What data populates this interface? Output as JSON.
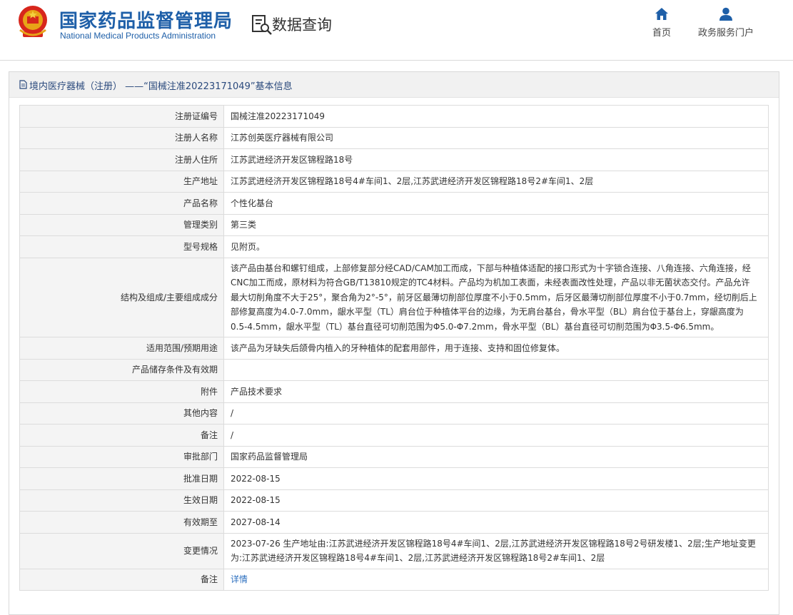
{
  "header": {
    "site_name_cn": "国家药品监督管理局",
    "site_name_en": "National Medical Products Administration",
    "page_title": "数据查询",
    "nav": [
      {
        "label": "首页",
        "icon": "home-icon"
      },
      {
        "label": "政务服务门户",
        "icon": "user-icon"
      }
    ]
  },
  "panel": {
    "title": "境内医疗器械（注册） ——“国械注准20223171049”基本信息",
    "rows": [
      {
        "label": "注册证编号",
        "value": "国械注准20223171049"
      },
      {
        "label": "注册人名称",
        "value": "江苏创英医疗器械有限公司"
      },
      {
        "label": "注册人住所",
        "value": "江苏武进经济开发区锦程路18号"
      },
      {
        "label": "生产地址",
        "value": "江苏武进经济开发区锦程路18号4#车间1、2层,江苏武进经济开发区锦程路18号2#车间1、2层"
      },
      {
        "label": "产品名称",
        "value": "个性化基台"
      },
      {
        "label": "管理类别",
        "value": "第三类"
      },
      {
        "label": "型号规格",
        "value": "见附页。"
      },
      {
        "label": "结构及组成/主要组成成分",
        "value": "该产品由基台和螺钉组成，上部修复部分经CAD/CAM加工而成，下部与种植体适配的接口形式为十字锁合连接、八角连接、六角连接，经CNC加工而成，原材料为符合GB/T13810规定的TC4材料。产品均为机加工表面，未经表面改性处理，产品以非无菌状态交付。产品允许最大切削角度不大于25°，聚合角为2°-5°，前牙区最薄切削部位厚度不小于0.5mm，后牙区最薄切削部位厚度不小于0.7mm，经切削后上部修复高度为4.0-7.0mm，龈水平型（TL）肩台位于种植体平台的边缘，为无肩台基台，骨水平型（BL）肩台位于基台上，穿龈高度为0.5-4.5mm，龈水平型（TL）基台直径可切削范围为Φ5.0-Φ7.2mm，骨水平型（BL）基台直径可切削范围为Φ3.5-Φ6.5mm。"
      },
      {
        "label": "适用范围/预期用途",
        "value": "该产品为牙缺失后颌骨内植入的牙种植体的配套用部件，用于连接、支持和固位修复体。"
      },
      {
        "label": "产品储存条件及有效期",
        "value": ""
      },
      {
        "label": "附件",
        "value": "产品技术要求"
      },
      {
        "label": "其他内容",
        "value": "/"
      },
      {
        "label": "备注",
        "value": "/"
      },
      {
        "label": "审批部门",
        "value": "国家药品监督管理局"
      },
      {
        "label": "批准日期",
        "value": "2022-08-15"
      },
      {
        "label": "生效日期",
        "value": "2022-08-15"
      },
      {
        "label": "有效期至",
        "value": "2027-08-14"
      },
      {
        "label": "变更情况",
        "value": "2023-07-26 生产地址由:江苏武进经济开发区锦程路18号4#车间1、2层,江苏武进经济开发区锦程路18号2号研发楼1、2层;生产地址变更为:江苏武进经济开发区锦程路18号4#车间1、2层,江苏武进经济开发区锦程路18号2#车间1、2层"
      },
      {
        "label": "备注",
        "value": "详情"
      }
    ]
  },
  "colors": {
    "brand_blue": "#1e5fa8",
    "label_bg": "#f4f4f4",
    "link_blue": "#2c6fbf"
  }
}
